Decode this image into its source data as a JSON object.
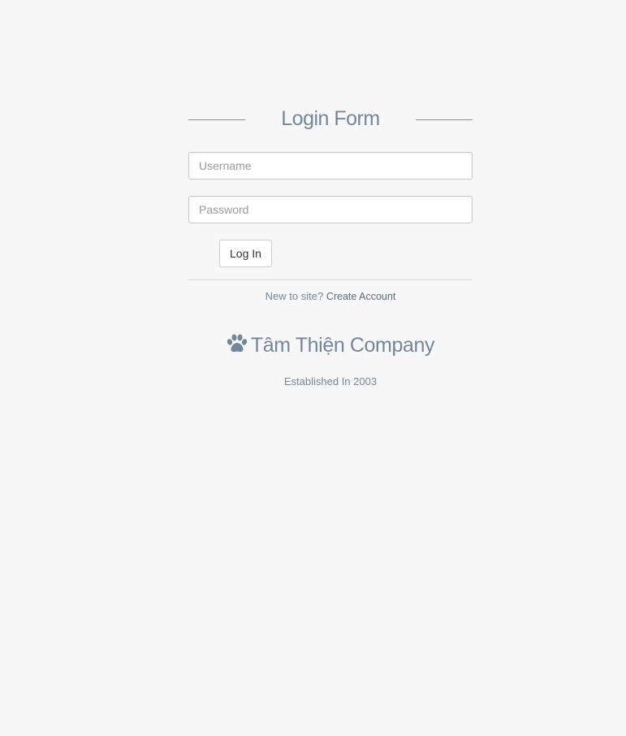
{
  "form": {
    "title": "Login Form",
    "username_placeholder": "Username",
    "password_placeholder": "Password",
    "login_button": "Log In"
  },
  "signup": {
    "prompt": "New to site?",
    "link_label": "Create Account"
  },
  "brand": {
    "icon": "paw-icon",
    "name": "Tâm Thiện Company",
    "established": "Established In 2003"
  },
  "colors": {
    "background": "#f7f7f7",
    "text": "#73879c"
  }
}
